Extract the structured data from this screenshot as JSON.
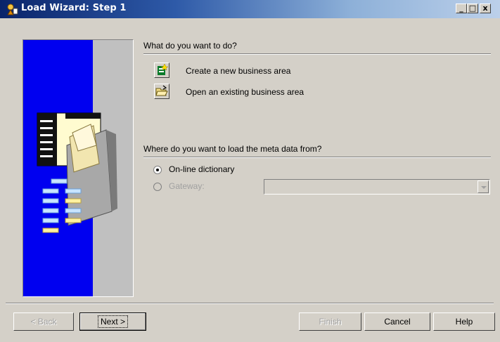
{
  "window": {
    "title": "Load Wizard: Step 1",
    "controls": {
      "minimize": "_",
      "maximize": "□",
      "close": "x"
    }
  },
  "section1": {
    "question": "What do you want to do?",
    "options": [
      {
        "label": "Create a new business area",
        "icon": "new-business-area-icon"
      },
      {
        "label": "Open an existing business area",
        "icon": "open-folder-icon"
      }
    ]
  },
  "section2": {
    "question": "Where do you want to load the meta data from?",
    "radios": [
      {
        "label": "On-line dictionary",
        "checked": true,
        "enabled": true
      },
      {
        "label": "Gateway:",
        "checked": false,
        "enabled": false
      }
    ],
    "gateway_value": ""
  },
  "buttons": {
    "back": "< Back",
    "next": "Next >",
    "finish": "Finish",
    "cancel": "Cancel",
    "help": "Help"
  },
  "colors": {
    "titlebar_start": "#0a246a",
    "dialog_face": "#d4d0c8",
    "art_blue": "#0000f0"
  }
}
